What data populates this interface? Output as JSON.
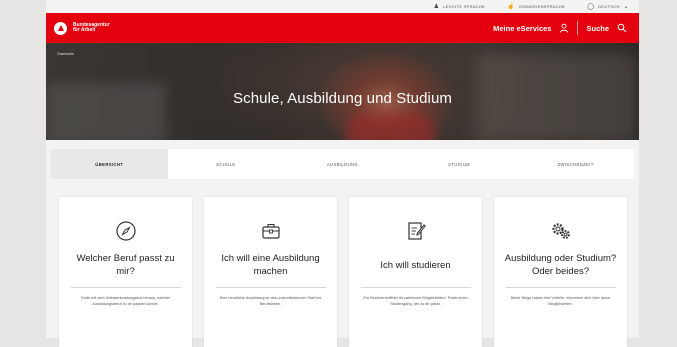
{
  "utility_bar": {
    "items": [
      {
        "label": "LEICHTE SPRACHE",
        "icon": "person-icon"
      },
      {
        "label": "GEBÄRDENSPRACHE",
        "icon": "hand-icon"
      },
      {
        "label": "DEUTSCH",
        "icon": "globe-icon"
      }
    ]
  },
  "header": {
    "logo_line1": "Bundesagentur",
    "logo_line2": "für Arbeit",
    "meine_services": "Meine eServices",
    "search_label": "Suche"
  },
  "hero": {
    "breadcrumb": "Startseite",
    "title": "Schule, Ausbildung und Studium"
  },
  "tabs": [
    {
      "label": "ÜBERSICHT",
      "active": true
    },
    {
      "label": "SCHULE",
      "active": false
    },
    {
      "label": "AUSBILDUNG",
      "active": false
    },
    {
      "label": "STUDIUM",
      "active": false
    },
    {
      "label": "ZWISCHENZEIT",
      "active": false
    }
  ],
  "cards": [
    {
      "icon": "compass-icon",
      "title": "Welcher Beruf passt zu mir?",
      "desc": "Finde mit dem Selbsterkundungstool heraus, welcher Ausbildungsberuf zu dir passen könnte."
    },
    {
      "icon": "toolbox-icon",
      "title": "Ich will eine Ausbildung machen",
      "desc": "Eine berufliche Ausbildung ist dein zukunftssicherer Start ins Berufsleben."
    },
    {
      "icon": "document-pen-icon",
      "title": "Ich will studieren",
      "desc": "Ein Studium eröffnet dir zahlreiche Möglichkeiten. Finde einen Studiengang, der zu dir passt."
    },
    {
      "icon": "gears-icon",
      "title": "Ausbildung oder Studium? Oder beides?",
      "desc": "Beide Wege haben ihre Vorteile. Informiere dich über deine Möglichkeiten."
    }
  ],
  "colors": {
    "brand_red": "#e3000f"
  }
}
